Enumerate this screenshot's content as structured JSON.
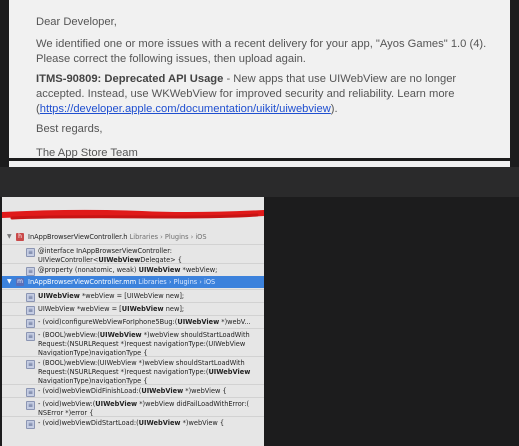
{
  "email": {
    "greeting": "Dear Developer,",
    "intro": "We identified one or more issues with a recent delivery for your app, \"Ayos Games\" 1.0 (4). Please correct the following issues, then upload again.",
    "issue_title": "ITMS-90809: Deprecated API Usage",
    "issue_text": " - New apps that use UIWebView are no longer accepted. Instead, use WKWebView for improved security and reliability. Learn more (",
    "issue_link": "https://developer.apple.com/documentation/uikit/uiwebview",
    "issue_end": ").",
    "regards": "Best regards,",
    "signature": "The App Store Team"
  },
  "colors": {
    "selection": "#3c82dc",
    "link": "#1f4fd0",
    "redaction": "#e01a1a"
  },
  "search_results": {
    "files": [
      {
        "name": "InAppBrowserViewController.h",
        "path": "Libraries › Plugins › iOS",
        "icon": "header-file-icon",
        "selected": false,
        "results": [
          {
            "pre": "@interface InAppBrowserViewController: UIViewController<",
            "match": "UIWebView",
            "post": "Delegate> {"
          },
          {
            "pre": "@property (nonatomic, weak) ",
            "match": "UIWebView",
            "post": " *webView;"
          }
        ]
      },
      {
        "name": "InAppBrowserViewController.mm",
        "path": "Libraries › Plugins › iOS",
        "icon": "implementation-file-icon",
        "selected": true,
        "results": [
          {
            "pre": "",
            "match": "UIWebView",
            "post": " *webView = [UIWebView new];"
          },
          {
            "pre": "UIWebView *webView = [",
            "match": "UIWebView",
            "post": " new];"
          },
          {
            "pre": "- (void)configureWebViewForIphone5Bug:(",
            "match": "UIWebView",
            "post": " *)webV..."
          },
          {
            "pre": "- (BOOL)webView:(",
            "match": "UIWebView",
            "post": " *)webView shouldStartLoadWith Request:(NSURLRequest *)request navigationType:(UIWebView NavigationType)navigationType {"
          },
          {
            "pre": "- (BOOL)webView:(UIWebView *)webView shouldStartLoadWith Request:(NSURLRequest *)request navigationType:(",
            "match": "UIWebView",
            "post": " NavigationType)navigationType {"
          },
          {
            "pre": "- (void)webViewDidFinishLoad:(",
            "match": "UIWebView",
            "post": " *)webView {"
          },
          {
            "pre": "- (void)webView:(",
            "match": "UIWebView",
            "post": " *)webView didFailLoadWithError:( NSError *)error {"
          },
          {
            "pre": "- (void)webViewDidStartLoad:(",
            "match": "UIWebView",
            "post": " *)webView {"
          }
        ]
      }
    ]
  }
}
